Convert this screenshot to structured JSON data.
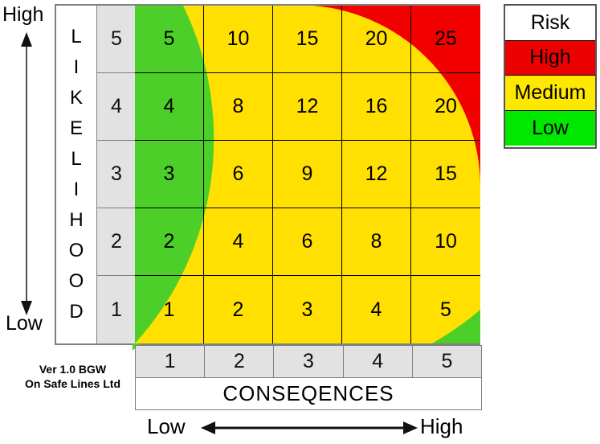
{
  "axes": {
    "vertical": {
      "label": "LIKELIHOOD",
      "high": "High",
      "low": "Low"
    },
    "horizontal": {
      "label": "CONSEQENCES",
      "low": "Low",
      "high": "High"
    }
  },
  "credit": {
    "line1": "Ver 1.0 BGW",
    "line2": "On Safe Lines Ltd"
  },
  "legend": {
    "title": "Risk",
    "items": [
      {
        "label": "High",
        "color": "#ee0000"
      },
      {
        "label": "Medium",
        "color": "#ffe800"
      },
      {
        "label": "Low",
        "color": "#00e800"
      }
    ]
  },
  "colors": {
    "low": "#4ccf28",
    "medium": "#ffe000",
    "high": "#f20000",
    "scale_bg": "#e2e2e2",
    "grid_line": "#000000",
    "frame": "#808080"
  },
  "chart_data": {
    "type": "heatmap",
    "title": "Risk Matrix",
    "xlabel": "CONSEQENCES",
    "ylabel": "LIKELIHOOD",
    "x_categories": [
      "1",
      "2",
      "3",
      "4",
      "5"
    ],
    "y_categories": [
      "5",
      "4",
      "3",
      "2",
      "1"
    ],
    "x_range_labels": [
      "Low",
      "High"
    ],
    "y_range_labels": [
      "Low",
      "High"
    ],
    "grid": true,
    "legend_position": "right",
    "rows": [
      {
        "likelihood": "5",
        "cells": [
          {
            "value": "5",
            "risk": "Low"
          },
          {
            "value": "10",
            "risk": "Medium"
          },
          {
            "value": "15",
            "risk": "Medium"
          },
          {
            "value": "20",
            "risk": "High"
          },
          {
            "value": "25",
            "risk": "High"
          }
        ]
      },
      {
        "likelihood": "4",
        "cells": [
          {
            "value": "4",
            "risk": "Low"
          },
          {
            "value": "8",
            "risk": "Medium"
          },
          {
            "value": "12",
            "risk": "Medium"
          },
          {
            "value": "16",
            "risk": "High"
          },
          {
            "value": "20",
            "risk": "High"
          }
        ]
      },
      {
        "likelihood": "3",
        "cells": [
          {
            "value": "3",
            "risk": "Low"
          },
          {
            "value": "6",
            "risk": "Medium"
          },
          {
            "value": "9",
            "risk": "Medium"
          },
          {
            "value": "12",
            "risk": "Medium"
          },
          {
            "value": "15",
            "risk": "Medium"
          }
        ]
      },
      {
        "likelihood": "2",
        "cells": [
          {
            "value": "2",
            "risk": "Low"
          },
          {
            "value": "4",
            "risk": "Low"
          },
          {
            "value": "6",
            "risk": "Medium"
          },
          {
            "value": "8",
            "risk": "Medium"
          },
          {
            "value": "10",
            "risk": "Medium"
          }
        ]
      },
      {
        "likelihood": "1",
        "cells": [
          {
            "value": "1",
            "risk": "Low"
          },
          {
            "value": "2",
            "risk": "Low"
          },
          {
            "value": "3",
            "risk": "Low"
          },
          {
            "value": "4",
            "risk": "Low"
          },
          {
            "value": "5",
            "risk": "Low"
          }
        ]
      }
    ]
  }
}
